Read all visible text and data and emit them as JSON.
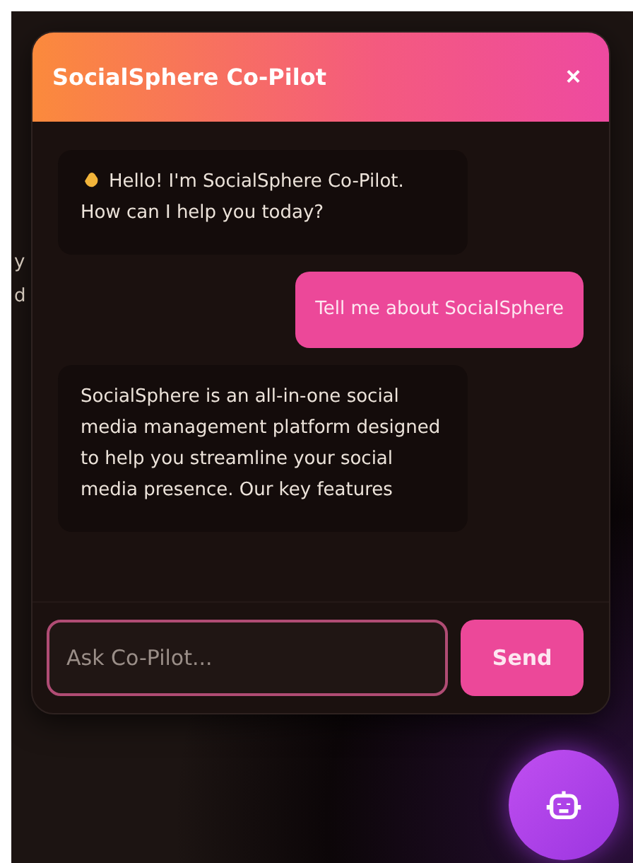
{
  "background_text": [
    "y",
    "d"
  ],
  "chat": {
    "title": "SocialSphere Co-Pilot",
    "close": "×",
    "messages": [
      {
        "kind": "bot",
        "wave": true,
        "text": "Hello! I'm SocialSphere Co-Pilot. How can I help you today?"
      },
      {
        "kind": "user",
        "text": "Tell me about SocialSphere"
      },
      {
        "kind": "bot",
        "wave": false,
        "text": "SocialSphere is an all-in-one social media management platform designed to help you streamline your social media presence. Our key features"
      }
    ],
    "input": {
      "placeholder": "Ask Co-Pilot..."
    },
    "send": "Send"
  }
}
